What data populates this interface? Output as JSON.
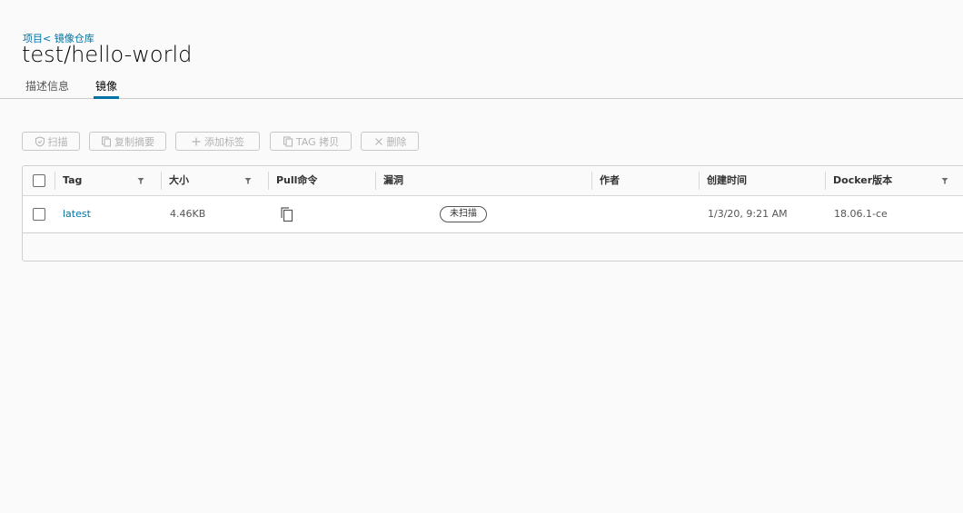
{
  "breadcrumb": {
    "project": "项目",
    "separator": "<",
    "repo": "镜像仓库"
  },
  "title": "test/hello-world",
  "tabs": [
    {
      "label": "描述信息",
      "active": false
    },
    {
      "label": "镜像",
      "active": true
    }
  ],
  "toolbar": {
    "scan": "扫描",
    "copy_digest": "复制摘要",
    "add_label": "添加标签",
    "tag_copy": "TAG 拷贝",
    "delete": "删除"
  },
  "table": {
    "columns": [
      "Tag",
      "大小",
      "Pull命令",
      "漏洞",
      "作者",
      "创建时间",
      "Docker版本"
    ],
    "rows": [
      {
        "tag": "latest",
        "size": "4.46KB",
        "vulnerability": "未扫描",
        "author": "",
        "created": "1/3/20, 9:21 AM",
        "docker_version": "18.06.1-ce"
      }
    ]
  },
  "colors": {
    "accent": "#0072a3",
    "disabled": "#b3b3b3",
    "border": "#cfcfcf"
  }
}
